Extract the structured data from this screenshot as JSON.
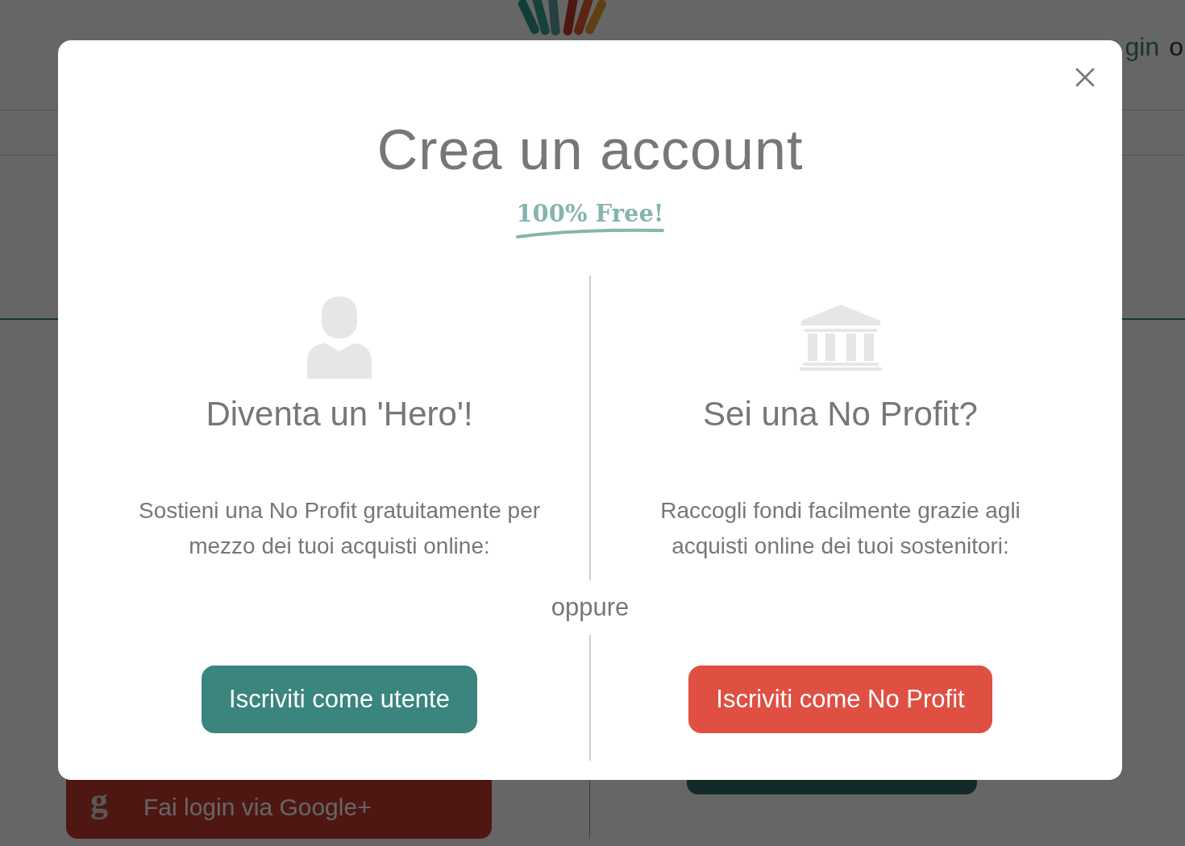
{
  "background": {
    "header_link": "gin",
    "header_text": "o",
    "google_icon": "g",
    "google_button": "Fai login via Google+"
  },
  "modal": {
    "title": "Crea un account",
    "badge": "100% Free!",
    "separator": "oppure",
    "options": [
      {
        "kind": "user",
        "heading": "Diventa un 'Hero'!",
        "description": "Sostieni una No Profit gratuitamente per mezzo dei tuoi acquisti online:",
        "button": "Iscriviti come utente",
        "color": "#3a857e"
      },
      {
        "kind": "organization",
        "heading": "Sei una No Profit?",
        "description": "Raccogli fondi facilmente grazie agli acquisti online dei tuoi sostenitori:",
        "button": "Iscriviti come No Profit",
        "color": "#e05042"
      }
    ]
  }
}
